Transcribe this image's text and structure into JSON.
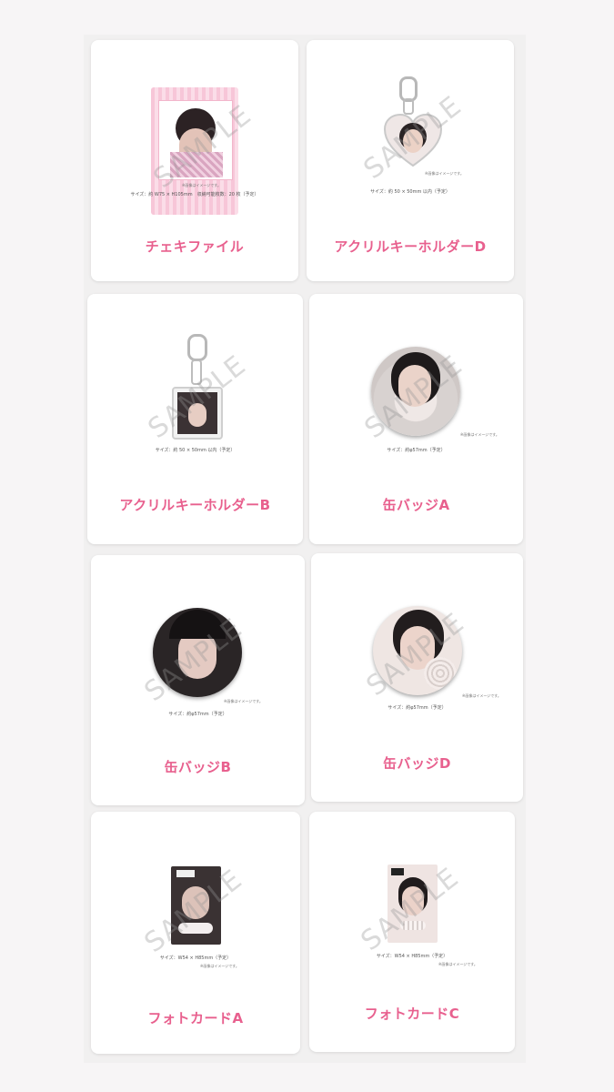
{
  "watermark": "SAMPLE",
  "note": "※画像はイメージです。",
  "items": [
    {
      "name": "チェキファイル",
      "spec": "サイズ：約 W75 × H105mm　収納可能枚数：20 枚（予定）"
    },
    {
      "name": "アクリルキーホルダーD",
      "spec": "サイズ：約 50 × 50mm 以内（予定）"
    },
    {
      "name": "アクリルキーホルダーB",
      "spec": "サイズ：約 50 × 50mm 以内（予定）"
    },
    {
      "name": "缶バッジA",
      "spec": "サイズ：約φ57mm（予定）"
    },
    {
      "name": "缶バッジB",
      "spec": "サイズ：約φ57mm（予定）"
    },
    {
      "name": "缶バッジD",
      "spec": "サイズ：約φ57mm（予定）"
    },
    {
      "name": "フォトカードA",
      "spec": "サイズ：W54 × H85mm（予定）"
    },
    {
      "name": "フォトカードC",
      "spec": "サイズ：W54 × H85mm（予定）"
    }
  ]
}
